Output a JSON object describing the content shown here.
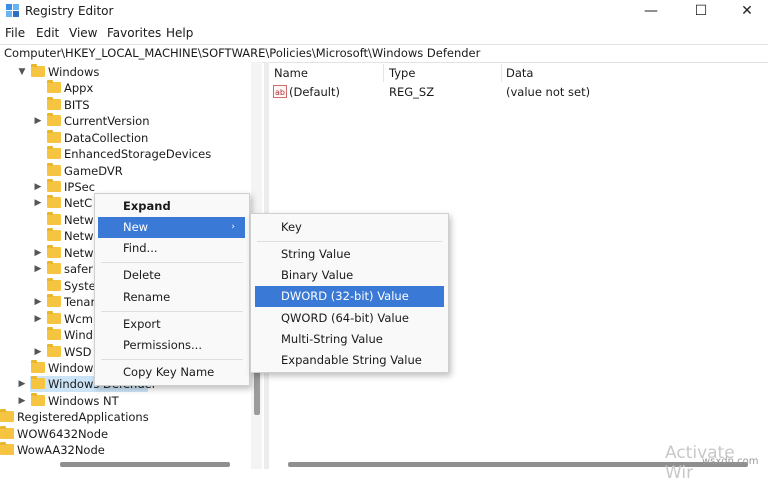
{
  "window": {
    "title": "Registry Editor",
    "controls": {
      "minimize": "—",
      "maximize": "☐",
      "close": "✕"
    }
  },
  "menu": [
    "File",
    "Edit",
    "View",
    "Favorites",
    "Help"
  ],
  "address": "Computer\\HKEY_LOCAL_MACHINE\\SOFTWARE\\Policies\\Microsoft\\Windows Defender",
  "tree": [
    {
      "label": "Windows",
      "chevron": "v"
    },
    {
      "label": "Appx",
      "chevron": ""
    },
    {
      "label": "BITS",
      "chevron": ""
    },
    {
      "label": "CurrentVersion",
      "chevron": ">"
    },
    {
      "label": "DataCollection",
      "chevron": ""
    },
    {
      "label": "EnhancedStorageDevices",
      "chevron": ""
    },
    {
      "label": "GameDVR",
      "chevron": ""
    },
    {
      "label": "IPSec",
      "chevron": ">"
    },
    {
      "label": "NetC",
      "chevron": ">"
    },
    {
      "label": "Netw",
      "chevron": ""
    },
    {
      "label": "Netw",
      "chevron": ""
    },
    {
      "label": "Netw",
      "chevron": ">"
    },
    {
      "label": "safer",
      "chevron": ">"
    },
    {
      "label": "Syste",
      "chevron": ""
    },
    {
      "label": "Tenar",
      "chevron": ">"
    },
    {
      "label": "Wcm",
      "chevron": ">"
    },
    {
      "label": "Wind",
      "chevron": ""
    },
    {
      "label": "WSD",
      "chevron": ">"
    },
    {
      "label": "Window",
      "chevron": ""
    },
    {
      "label": "Windows Defender",
      "chevron": ">"
    },
    {
      "label": "Windows NT",
      "chevron": ">"
    },
    {
      "label": "RegisteredApplications",
      "chevron": ""
    },
    {
      "label": "WOW6432Node",
      "chevron": ""
    },
    {
      "label": "WowAA32Node",
      "chevron": ""
    }
  ],
  "columns": {
    "name": "Name",
    "type": "Type",
    "data": "Data"
  },
  "values": [
    {
      "icon": "ab",
      "name": "(Default)",
      "type": "REG_SZ",
      "data": "(value not set)"
    }
  ],
  "context_menu": {
    "items": [
      "Expand",
      "New",
      "Find...",
      "Delete",
      "Rename",
      "Export",
      "Permissions...",
      "Copy Key Name"
    ],
    "arrow": "›"
  },
  "submenu": {
    "items": [
      "Key",
      "String Value",
      "Binary Value",
      "DWORD (32-bit) Value",
      "QWORD (64-bit) Value",
      "Multi-String Value",
      "Expandable String Value"
    ]
  },
  "watermark": "Activate Wir",
  "site": "wsxdn.com",
  "colors": {
    "highlight": "#3b79d6",
    "selection": "#cce4f7",
    "folder": "#f5c542"
  }
}
